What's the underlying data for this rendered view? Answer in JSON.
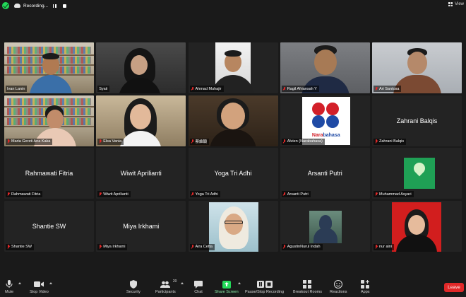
{
  "topbar": {
    "recording_label": "Recording...",
    "view_label": "View"
  },
  "participants": [
    {
      "name": "Ivan Lanin",
      "muted": false,
      "video": "bookshelf",
      "active": true
    },
    {
      "name": "Syaii",
      "muted": false,
      "video": "room"
    },
    {
      "name": "Ahmad Muhajir",
      "muted": true,
      "video": "light"
    },
    {
      "name": "Ragil Afriansah Y",
      "muted": true,
      "video": "wall"
    },
    {
      "name": "Ari Santosa",
      "muted": true,
      "video": "wall2"
    },
    {
      "name": "Maria Goreti Ana Kaka",
      "muted": true,
      "video": "bookshelf"
    },
    {
      "name": "Elsa Vania",
      "muted": true,
      "video": "cream"
    },
    {
      "name": "蔡維穎",
      "muted": true,
      "video": "warm"
    },
    {
      "name": "Alvien (Narabahasa)",
      "muted": true,
      "video": "logo",
      "logo_text_a": "Nara",
      "logo_text_b": "bahasa"
    },
    {
      "name": "Zahrani Balqis",
      "muted": true,
      "display": "Zahrani Balqis"
    },
    {
      "name": "Rahmawati Fitria",
      "muted": true,
      "display": "Rahmawati Fitria"
    },
    {
      "name": "Wiwit Aprilianti",
      "muted": true,
      "display": "Wiwit Aprilianti"
    },
    {
      "name": "Yoga Tri Adhi",
      "muted": true,
      "display": "Yoga Tri Adhi"
    },
    {
      "name": "Arsanti Putri",
      "muted": true,
      "display": "Arsanti Putri"
    },
    {
      "name": "Muhammad Asyari",
      "muted": true,
      "video": "green-logo"
    },
    {
      "name": "Shantie SW",
      "muted": true,
      "display": "Shantie SW"
    },
    {
      "name": "Miya Irkhami",
      "muted": true,
      "display": "Miya Irkhami"
    },
    {
      "name": "Aira Cetta",
      "muted": true,
      "video": "photo-hijab"
    },
    {
      "name": "AgustinNurul Indah",
      "muted": true,
      "video": "photo-small"
    },
    {
      "name": "nur aini",
      "muted": true,
      "video": "photo-red"
    }
  ],
  "toolbar": {
    "mute": "Mute",
    "stop_video": "Stop Video",
    "security": "Security",
    "participants": "Participants",
    "participants_count": "20",
    "chat": "Chat",
    "share_screen": "Share Screen",
    "pause_recording": "Pause/Stop Recording",
    "breakout_rooms": "Breakout Rooms",
    "reactions": "Reactions",
    "apps": "Apps",
    "leave": "Leave"
  },
  "colors": {
    "active_speaker": "#23d959",
    "muted_red": "#e02828",
    "share_green": "#23d959",
    "leave_red": "#e02828",
    "tile_bg": "#232323",
    "app_bg": "#1a1a1a"
  }
}
